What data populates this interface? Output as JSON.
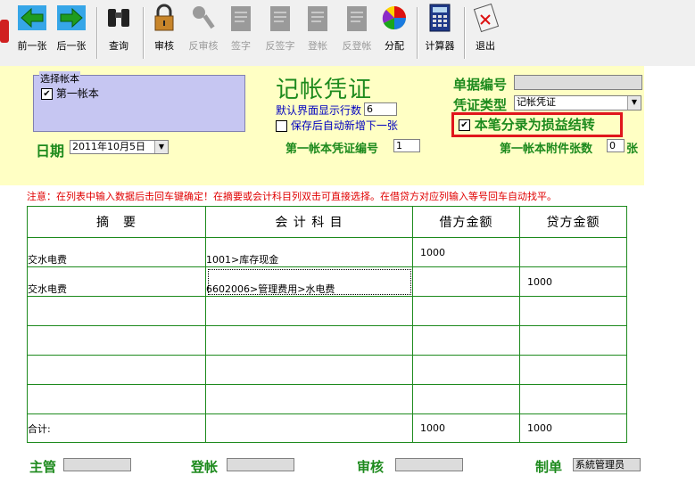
{
  "toolbar": {
    "items": [
      {
        "label": "前一张",
        "enabled": true
      },
      {
        "label": "后一张",
        "enabled": true
      },
      {
        "label": "查询",
        "enabled": true
      },
      {
        "label": "审核",
        "enabled": true
      },
      {
        "label": "反审核",
        "enabled": false
      },
      {
        "label": "签字",
        "enabled": false
      },
      {
        "label": "反签字",
        "enabled": false
      },
      {
        "label": "登帐",
        "enabled": false
      },
      {
        "label": "反登帐",
        "enabled": false
      },
      {
        "label": "分配",
        "enabled": true
      },
      {
        "label": "计算器",
        "enabled": true
      },
      {
        "label": "退出",
        "enabled": true
      }
    ]
  },
  "account_book": {
    "legend": "选择帐本",
    "item_label": "第一帐本",
    "checked": true
  },
  "header": {
    "title": "记帐凭证",
    "default_rows_label": "默认界面显示行数",
    "default_rows_value": "6",
    "auto_new_label": "保存后自动新增下一张",
    "auto_new_checked": false,
    "doc_no_label": "单据编号",
    "doc_no_value": "",
    "voucher_type_label": "凭证类型",
    "voucher_type_value": "记帐凭证",
    "profit_transfer_label": "本笔分录为损益结转",
    "profit_transfer_checked": true,
    "date_label": "日期",
    "date_value": "2011年10月5日",
    "voucher_no_label": "第一帐本凭证编号",
    "voucher_no_value": "1",
    "attach_label": "第一帐本附件张数",
    "attach_value": "0",
    "attach_unit": "张"
  },
  "note": "注意：在列表中输入数据后击回车键确定！在摘要或会计科目列双击可直接选择。在借贷方对应列输入等号回车自动找平。",
  "table": {
    "columns": [
      "摘　要",
      "会 计 科 目",
      "借方金额",
      "贷方金额"
    ],
    "rows": [
      {
        "summary": "交水电费",
        "account": "1001>库存现金",
        "debit": "1000",
        "credit": ""
      },
      {
        "summary": "交水电费",
        "account": "6602006>管理费用>水电费",
        "debit": "",
        "credit": "1000"
      },
      {
        "summary": "",
        "account": "",
        "debit": "",
        "credit": ""
      },
      {
        "summary": "",
        "account": "",
        "debit": "",
        "credit": ""
      },
      {
        "summary": "",
        "account": "",
        "debit": "",
        "credit": ""
      },
      {
        "summary": "",
        "account": "",
        "debit": "",
        "credit": ""
      }
    ],
    "total": {
      "label": "合计:",
      "debit": "1000",
      "credit": "1000"
    }
  },
  "footer": {
    "supervisor_label": "主管",
    "supervisor_value": "",
    "posting_label": "登帐",
    "posting_value": "",
    "audit_label": "审核",
    "audit_value": "",
    "maker_label": "制单",
    "maker_value": "系統管理员"
  }
}
